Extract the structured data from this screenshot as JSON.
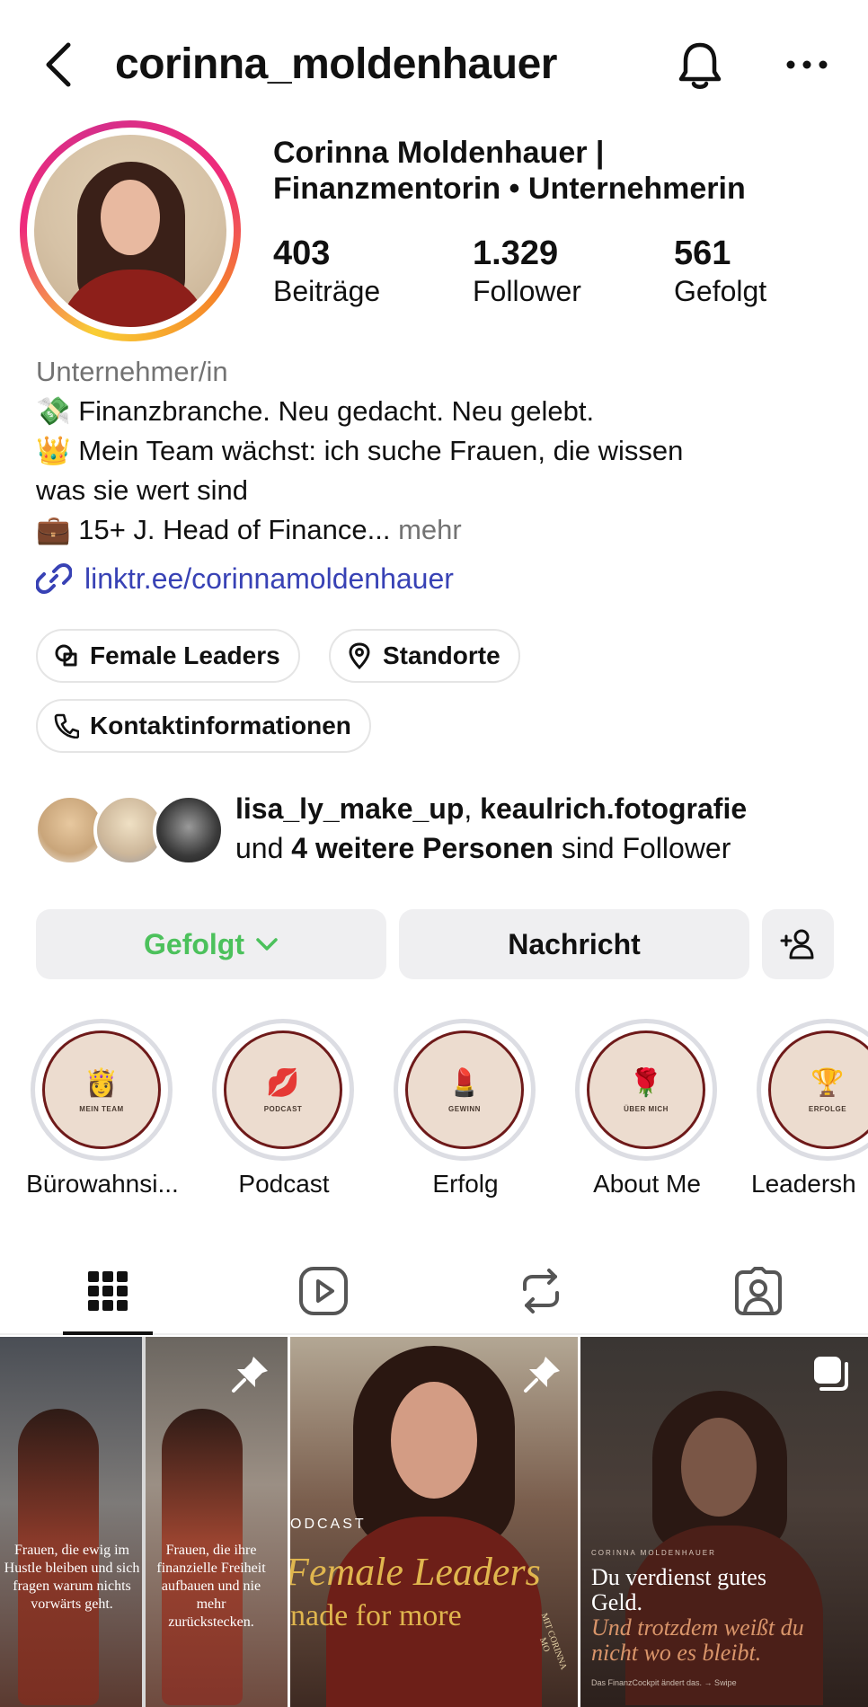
{
  "header": {
    "username": "corinna_moldenhauer",
    "back_icon": "chevron-left-icon",
    "bell_icon": "bell-icon",
    "more_icon": "more-horizontal-icon"
  },
  "profile": {
    "display_name_line1": "Corinna Moldenhauer |",
    "display_name_line2": "Finanzmentorin • Unternehmerin",
    "stats": [
      {
        "value": "403",
        "label": "Beiträge"
      },
      {
        "value": "1.329",
        "label": "Follower"
      },
      {
        "value": "561",
        "label": "Gefolgt"
      }
    ]
  },
  "bio": {
    "category": "Unternehmer/in",
    "line1_emoji": "💸",
    "line1": "Finanzbranche. Neu gedacht. Neu gelebt.",
    "line2_emoji": "👑",
    "line2": "Mein Team wächst: ich suche Frauen, die wissen",
    "line3": "was sie wert sind",
    "line4_emoji": "💼",
    "line4": "15+ J. Head of Finance...",
    "more": "mehr",
    "link": "linktr.ee/corinnamoldenhauer"
  },
  "chips": {
    "female_leaders": "Female Leaders",
    "locations": "Standorte",
    "contact": "Kontaktinformationen"
  },
  "followed_by": {
    "user1": "lisa_ly_make_up",
    "separator": ",",
    "user2": "keaulrich.fotografie",
    "prefix": "und",
    "others": "4 weitere Personen",
    "suffix": "sind Follower"
  },
  "actions": {
    "following": "Gefolgt",
    "message": "Nachricht",
    "add_person_icon": "add-person-icon"
  },
  "highlights": [
    {
      "label": "Bürowahnsi...",
      "emoji": "👸",
      "caption": "MEIN TEAM"
    },
    {
      "label": "Podcast",
      "emoji": "💋",
      "caption": "PODCAST"
    },
    {
      "label": "Erfolg",
      "emoji": "💄",
      "caption": "GEWINN"
    },
    {
      "label": "About Me",
      "emoji": "🌹",
      "caption": "ÜBER MICH"
    },
    {
      "label": "Leadersh",
      "emoji": "🏆",
      "caption": "ERFOLGE"
    }
  ],
  "tabs": [
    "grid-icon",
    "reels-icon",
    "reposts-icon",
    "tagged-icon"
  ],
  "posts": [
    {
      "left_text": "Frauen, die ewig im Hustle bleiben und sich fragen warum nichts vorwärts geht.",
      "right_text": "Frauen, die ihre finanzielle Freiheit aufbauen und nie mehr zurückstecken."
    },
    {
      "kicker": "ODCAST",
      "title": "Female Leaders",
      "subtitle": "nade for more",
      "stamp": "MIT CORINNA MO"
    },
    {
      "kicker": "CORINNA MOLDENHAUER",
      "line1": "Du verdienst gutes",
      "line2": "Geld.",
      "line3": "Und trotzdem weißt du",
      "line4": "nicht wo es bleibt.",
      "footer": "Das FinanzCockpit ändert das. → Swipe"
    }
  ]
}
